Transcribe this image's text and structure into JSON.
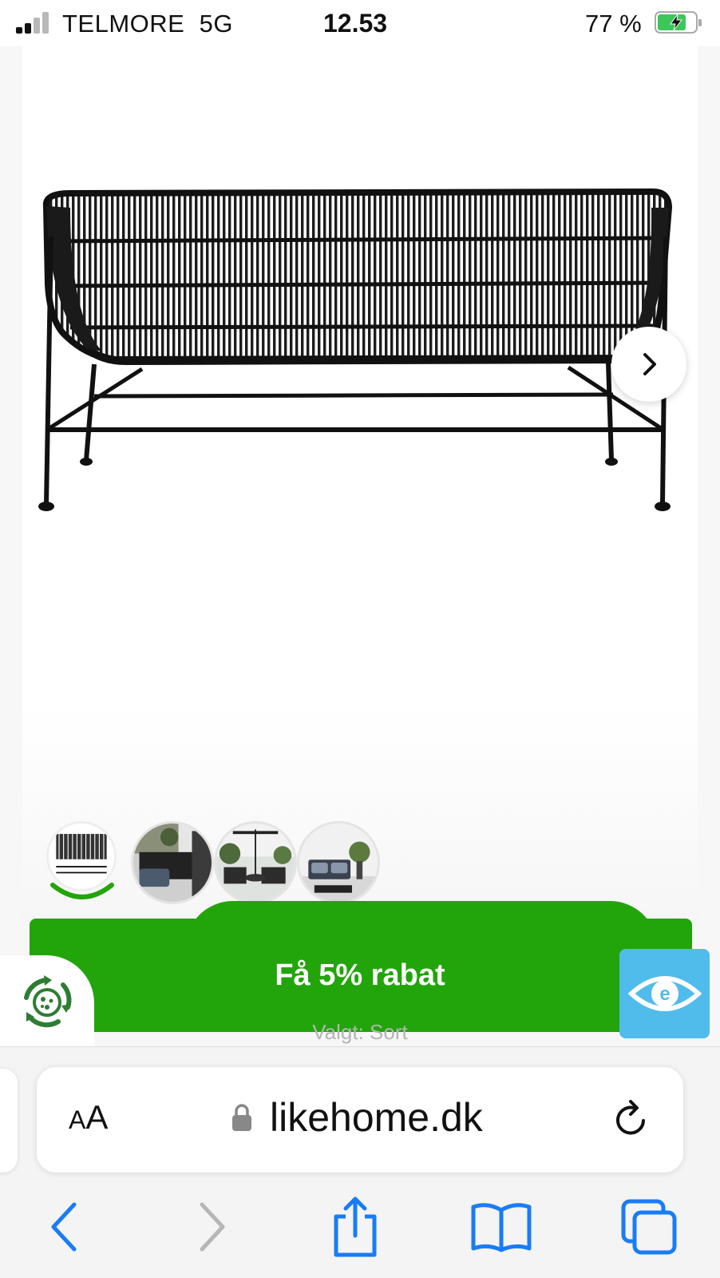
{
  "status_bar": {
    "carrier": "TELMORE",
    "network": "5G",
    "time": "12.53",
    "battery_percent": "77 %",
    "battery_level": 0.77,
    "battery_color": "#3dc65a",
    "signal_bars_active": 2,
    "signal_bars_total": 4
  },
  "product": {
    "image_icon": "rattan-sofa-image",
    "next_icon": "chevron-right-icon",
    "thumbnails": [
      {
        "icon": "sofa-thumbnail",
        "selected": true
      },
      {
        "icon": "lifestyle-thumbnail-1",
        "selected": false
      },
      {
        "icon": "lifestyle-thumbnail-2",
        "selected": false
      },
      {
        "icon": "lifestyle-thumbnail-3",
        "selected": false
      }
    ]
  },
  "promo": {
    "discount_label": "Få 5% rabat",
    "selected_text": "Valgt: Sort",
    "banner_color": "#22a50a",
    "recycle_icon": "recycle-icon",
    "eye_badge_color": "#4fbcec",
    "eye_badge_icon": "e-eye-icon"
  },
  "browser": {
    "text_size_label_small": "A",
    "text_size_label_large": "A",
    "url": "likehome.dk",
    "lock_icon": "lock-icon",
    "reload_icon": "reload-icon",
    "accent_color": "#1a7cf5",
    "nav": [
      "back-icon",
      "forward-icon",
      "share-icon",
      "bookmarks-icon",
      "tabs-icon"
    ]
  }
}
